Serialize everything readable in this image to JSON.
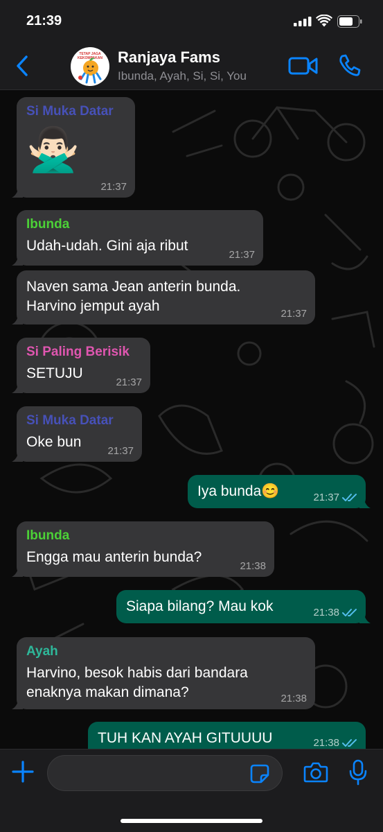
{
  "status_bar": {
    "time": "21:39"
  },
  "header": {
    "group_name": "Ranjaya Fams",
    "members": "Ibunda, Ayah, Si, Si, You",
    "avatar_caption": "TETAP JAGA KEKOMPAKAN"
  },
  "colors": {
    "accent": "#0a84ff",
    "outgoing_bubble": "#005c4b",
    "incoming_bubble": "#363638",
    "sender_si_muka_datar": "#4751b8",
    "sender_ibunda": "#4cd137",
    "sender_si_paling_berisik": "#e056b0",
    "sender_ayah": "#2eb89a",
    "read_ticks": "#53bdeb"
  },
  "messages": [
    {
      "sender": "Si Muka Datar",
      "sticker": "🙅🏻‍♂️",
      "time": "21:37"
    },
    {
      "sender": "Ibunda",
      "text": "Udah-udah. Gini aja ribut",
      "time": "21:37"
    },
    {
      "text": "Naven sama Jean anterin bunda. Harvino jemput ayah",
      "time": "21:37"
    },
    {
      "sender": "Si Paling Berisik",
      "text": "SETUJU",
      "time": "21:37"
    },
    {
      "sender": "Si Muka Datar",
      "text": "Oke bun",
      "time": "21:37"
    },
    {
      "text": "Iya bunda😊",
      "time": "21:37",
      "outgoing": true
    },
    {
      "sender": "Ibunda",
      "text": "Engga mau anterin bunda?",
      "time": "21:38"
    },
    {
      "text": "Siapa bilang? Mau kok",
      "time": "21:38",
      "outgoing": true
    },
    {
      "sender": "Ayah",
      "text": "Harvino, besok habis dari bandara enaknya makan dimana?",
      "time": "21:38"
    },
    {
      "text": "TUH KAN AYAH GITUUUU",
      "time": "21:38",
      "outgoing": true
    }
  ],
  "composer": {
    "placeholder": ""
  },
  "icons": {
    "back": "chevron-left-icon",
    "video_call": "video-camera-icon",
    "voice_call": "phone-icon",
    "attach": "plus-icon",
    "sticker": "sticker-icon",
    "camera": "camera-icon",
    "mic": "microphone-icon"
  }
}
